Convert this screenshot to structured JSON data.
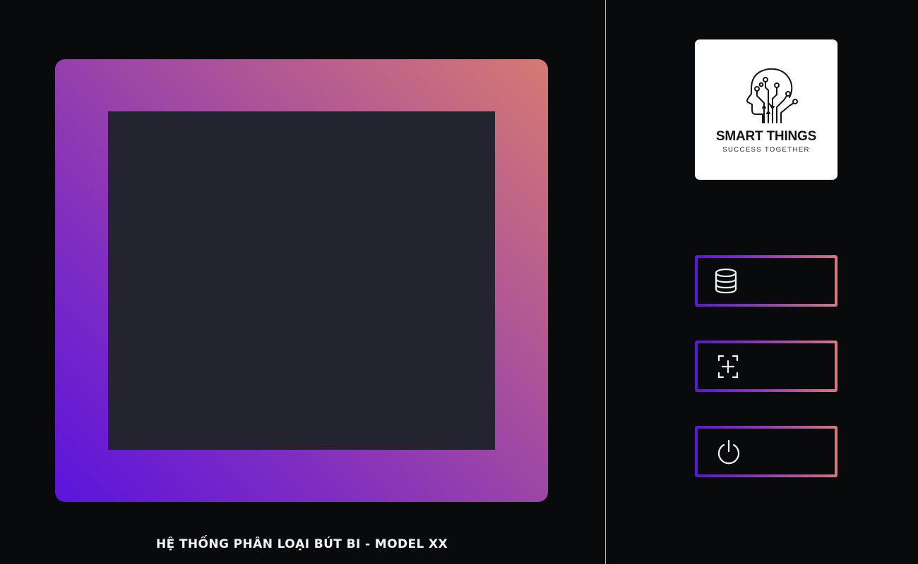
{
  "title": "HỆ THỐNG PHÂN LOẠI BÚT BI - MODEL XX",
  "logo": {
    "name": "SMART THINGS",
    "tagline": "SUCCESS TOGETHER"
  },
  "buttons": [
    {
      "id": "database",
      "icon": "database-icon",
      "label": ""
    },
    {
      "id": "capture",
      "icon": "capture-add-icon",
      "label": ""
    },
    {
      "id": "power",
      "icon": "power-icon",
      "label": ""
    }
  ],
  "colors": {
    "background": "#090a0c",
    "camera_view": "#23242f",
    "gradient_start": "#5a17d8",
    "gradient_end": "#d8787a",
    "text": "#f4f4f6",
    "divider": "#b9b9bd"
  }
}
